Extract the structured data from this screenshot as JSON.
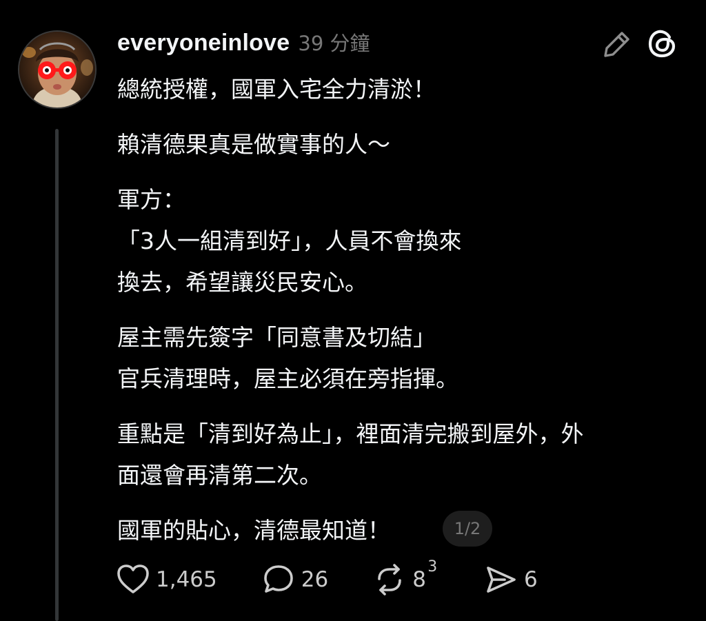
{
  "post": {
    "username": "everyoneinlove",
    "timestamp": "39 分鐘",
    "paragraphs": [
      {
        "lines": [
          "總統授權，國軍入宅全力清淤！"
        ]
      },
      {
        "lines": [
          "賴清德果真是做實事的人～"
        ]
      },
      {
        "lines": [
          "軍方：",
          "「3人一組清到好」，人員不會換來",
          "換去，希望讓災民安心。"
        ]
      },
      {
        "lines": [
          "屋主需先簽字「同意書及切結」",
          "官兵清理時，屋主必須在旁指揮。"
        ]
      },
      {
        "lines": [
          "重點是「清到好為止」，裡面清完搬到屋外，外",
          "面還會再清第二次。"
        ]
      },
      {
        "lines": [
          "國軍的貼心，清德最知道！"
        ]
      }
    ],
    "page_indicator": "1/2",
    "actions": {
      "likes": "1,465",
      "comments": "26",
      "reposts": "8",
      "reposts_superscript": "3",
      "shares": "6"
    },
    "icons": {
      "edit": "pencil-icon",
      "app": "threads-logo-icon",
      "like": "heart-icon",
      "comment": "comment-bubble-icon",
      "repost": "repost-icon",
      "share": "send-icon"
    },
    "colors": {
      "background": "#000000",
      "text": "#f3f5f7",
      "muted": "#777777",
      "thread_line": "#333638"
    }
  }
}
